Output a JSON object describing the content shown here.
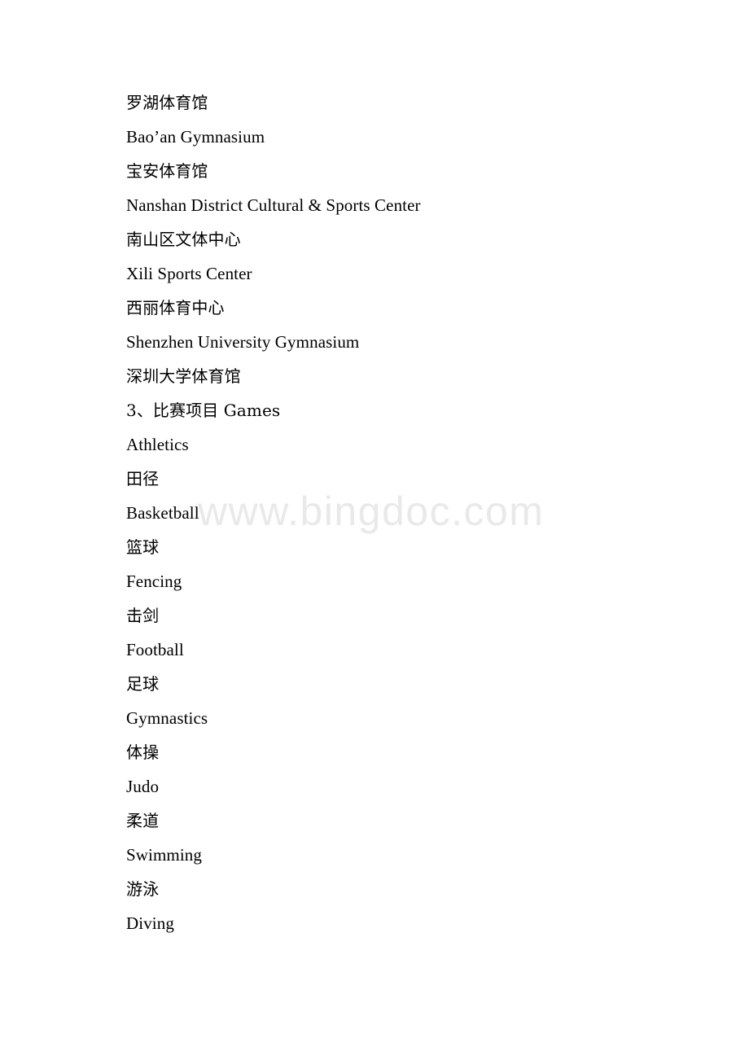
{
  "document": {
    "background_color": "#ffffff",
    "text_color": "#000000",
    "lines": [
      {
        "id": "line-1",
        "text": "罗湖体育馆",
        "script": "cjk"
      },
      {
        "id": "line-2",
        "text": "Bao’an Gymnasium",
        "script": "latin"
      },
      {
        "id": "line-3",
        "text": "宝安体育馆",
        "script": "cjk"
      },
      {
        "id": "line-4",
        "text": "Nanshan District Cultural & Sports Center",
        "script": "latin"
      },
      {
        "id": "line-5",
        "text": "南山区文体中心",
        "script": "cjk"
      },
      {
        "id": "line-6",
        "text": "Xili Sports Center",
        "script": "latin"
      },
      {
        "id": "line-7",
        "text": "西丽体育中心",
        "script": "cjk"
      },
      {
        "id": "line-8",
        "text": "Shenzhen University Gymnasium",
        "script": "latin"
      },
      {
        "id": "line-9",
        "text": "深圳大学体育馆",
        "script": "cjk"
      },
      {
        "id": "line-10",
        "text": "3、比赛项目 Games",
        "script": "mixed"
      },
      {
        "id": "line-11",
        "text": "Athletics",
        "script": "latin"
      },
      {
        "id": "line-12",
        "text": "田径",
        "script": "cjk"
      },
      {
        "id": "line-13",
        "text": "Basketball",
        "script": "latin"
      },
      {
        "id": "line-14",
        "text": "篮球",
        "script": "cjk"
      },
      {
        "id": "line-15",
        "text": "Fencing",
        "script": "latin"
      },
      {
        "id": "line-16",
        "text": "击剑",
        "script": "cjk"
      },
      {
        "id": "line-17",
        "text": "Football",
        "script": "latin"
      },
      {
        "id": "line-18",
        "text": "足球",
        "script": "cjk"
      },
      {
        "id": "line-19",
        "text": "Gymnastics",
        "script": "latin"
      },
      {
        "id": "line-20",
        "text": "体操",
        "script": "cjk"
      },
      {
        "id": "line-21",
        "text": "Judo",
        "script": "latin"
      },
      {
        "id": "line-22",
        "text": "柔道",
        "script": "cjk"
      },
      {
        "id": "line-23",
        "text": "Swimming",
        "script": "latin"
      },
      {
        "id": "line-24",
        "text": "游泳",
        "script": "cjk"
      },
      {
        "id": "line-25",
        "text": "Diving",
        "script": "latin"
      }
    ]
  },
  "watermark": {
    "text": "www.bingdoc.com",
    "color": "#e9e9e9"
  }
}
